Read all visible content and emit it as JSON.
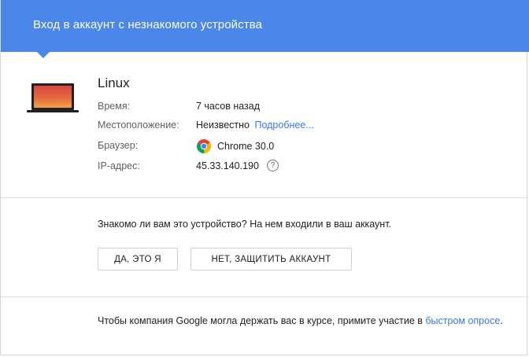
{
  "header": {
    "title": "Вход в аккаунт с незнакомого устройства",
    "color": "#4a87e8"
  },
  "device": {
    "name": "Linux",
    "icon": "laptop-icon",
    "rows": [
      {
        "label": "Время:",
        "value": "7 часов назад"
      },
      {
        "label": "Местоположение:",
        "value": "Неизвестно",
        "link": "Подробнее..."
      },
      {
        "label": "Браузер:",
        "value": "Chrome 30.0",
        "icon": "chrome-icon"
      },
      {
        "label": "IP-адрес:",
        "value": "45.33.140.190",
        "help_icon": "?"
      }
    ]
  },
  "confirm": {
    "question": "Знакомо ли вам это устройство? На нем входили в ваш аккаунт.",
    "yes_label": "ДА, ЭТО Я",
    "no_label": "НЕТ, ЗАЩИТИТЬ АККАУНТ"
  },
  "survey": {
    "text": "Чтобы компания Google могла держать вас в курсе, примите участие в ",
    "link": "быстром опросе",
    "suffix": "."
  },
  "colors": {
    "link": "#3b78e7",
    "accent": "#4a87e8"
  }
}
